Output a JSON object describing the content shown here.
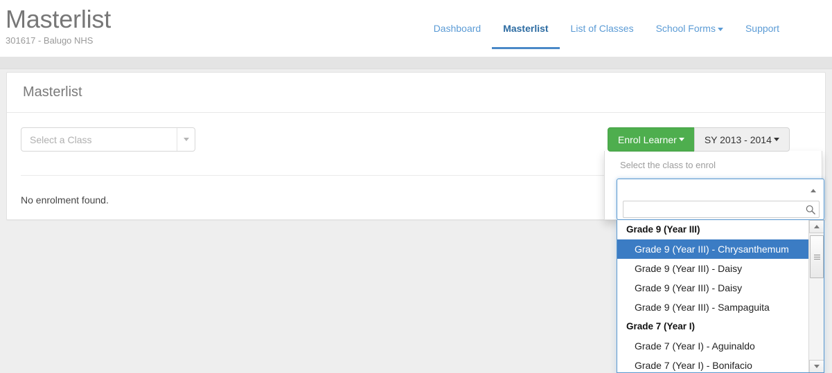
{
  "header": {
    "title": "Masterlist",
    "subtitle": "301617 - Balugo NHS",
    "nav": [
      {
        "label": "Dashboard",
        "active": false,
        "caret": false
      },
      {
        "label": "Masterlist",
        "active": true,
        "caret": false
      },
      {
        "label": "List of Classes",
        "active": false,
        "caret": false
      },
      {
        "label": "School Forms",
        "active": false,
        "caret": true
      },
      {
        "label": "Support",
        "active": false,
        "caret": false
      }
    ]
  },
  "panel": {
    "title": "Masterlist",
    "class_select": {
      "value": "Select a Class",
      "arrow_icon": "caret-down-icon"
    },
    "empty_message": "No enrolment found."
  },
  "actions": {
    "enrol_label": "Enrol Learner",
    "school_year_label": "SY 2013 - 2014"
  },
  "enrol_dropdown": {
    "hint": "Select the class to enrol",
    "search": {
      "value": "",
      "placeholder": "",
      "icon": "search-icon"
    },
    "collapse_icon": "caret-up-icon",
    "options": [
      {
        "type": "group",
        "label": "Grade 9 (Year III)"
      },
      {
        "type": "option",
        "label": "Grade 9 (Year III) - Chrysanthemum",
        "selected": true
      },
      {
        "type": "option",
        "label": "Grade 9 (Year III) - Daisy",
        "selected": false
      },
      {
        "type": "option",
        "label": "Grade 9 (Year III) - Daisy",
        "selected": false
      },
      {
        "type": "option",
        "label": "Grade 9 (Year III) - Sampaguita",
        "selected": false
      },
      {
        "type": "group",
        "label": "Grade 7 (Year I)"
      },
      {
        "type": "option",
        "label": "Grade 7 (Year I) - Aguinaldo",
        "selected": false
      },
      {
        "type": "option",
        "label": "Grade 7 (Year I) - Bonifacio",
        "selected": false
      }
    ]
  },
  "colors": {
    "brand_blue": "#5b9bd5",
    "active_blue": "#2d6ca2",
    "green": "#4eae4e",
    "highlight_blue": "#3b7cc4",
    "page_bg": "#eeeeee"
  }
}
